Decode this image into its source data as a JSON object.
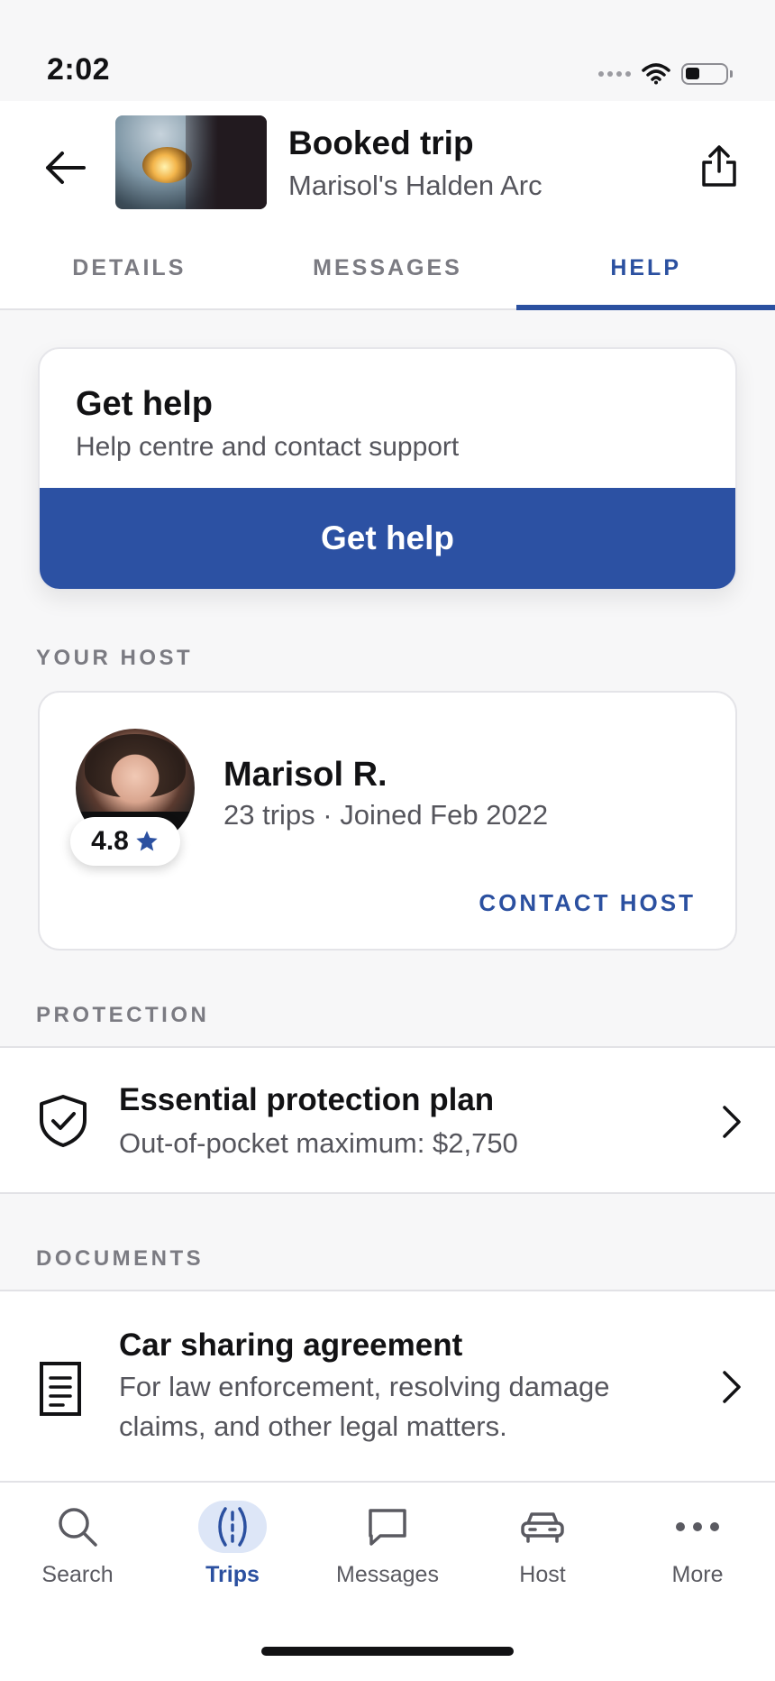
{
  "status_bar": {
    "time": "2:02"
  },
  "header": {
    "title": "Booked trip",
    "subtitle": "Marisol's Halden Arc"
  },
  "tabs": [
    {
      "label": "DETAILS",
      "active": false
    },
    {
      "label": "MESSAGES",
      "active": false
    },
    {
      "label": "HELP",
      "active": true
    }
  ],
  "help_card": {
    "title": "Get help",
    "subtitle": "Help centre and contact support",
    "button_label": "Get help"
  },
  "host_section": {
    "label": "YOUR HOST",
    "name": "Marisol R.",
    "meta": "23 trips · Joined Feb 2022",
    "rating": "4.8",
    "contact_label": "CONTACT HOST"
  },
  "protection_section": {
    "label": "PROTECTION",
    "title": "Essential protection plan",
    "subtitle": "Out-of-pocket maximum: $2,750"
  },
  "documents_section": {
    "label": "DOCUMENTS",
    "title": "Car sharing agreement",
    "subtitle": "For law enforcement, resolving damage claims, and other legal matters."
  },
  "bottom_nav": {
    "items": [
      {
        "label": "Search",
        "icon": "search-icon",
        "active": false
      },
      {
        "label": "Trips",
        "icon": "trips-road-icon",
        "active": true
      },
      {
        "label": "Messages",
        "icon": "message-icon",
        "active": false
      },
      {
        "label": "Host",
        "icon": "car-icon",
        "active": false
      },
      {
        "label": "More",
        "icon": "more-dots-icon",
        "active": false
      }
    ]
  },
  "colors": {
    "accent": "#2b50a0",
    "button": "#2c51a3",
    "background": "#f7f7f8",
    "text_secondary": "#55555c"
  }
}
